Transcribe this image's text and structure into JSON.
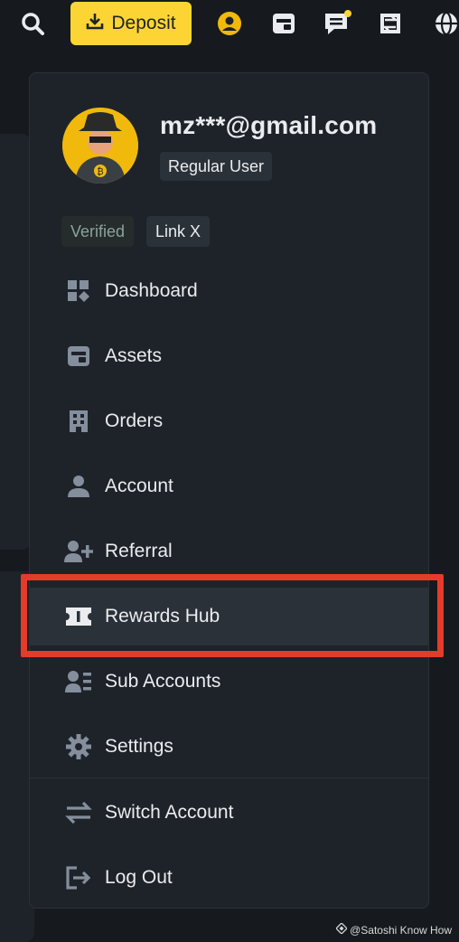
{
  "topbar": {
    "deposit_label": "Deposit",
    "icons": [
      "search-icon",
      "download-icon",
      "user-avatar-icon",
      "wallet-icon",
      "messages-icon",
      "transfer-icon",
      "globe-icon"
    ],
    "accent": "#fcd535"
  },
  "user": {
    "email": "mz***@gmail.com",
    "role": "Regular User",
    "verified_label": "Verified",
    "link_label": "Link X"
  },
  "menu": {
    "items": [
      {
        "label": "Dashboard",
        "icon": "dashboard-icon"
      },
      {
        "label": "Assets",
        "icon": "wallet-icon"
      },
      {
        "label": "Orders",
        "icon": "orders-icon"
      },
      {
        "label": "Account",
        "icon": "account-icon"
      },
      {
        "label": "Referral",
        "icon": "referral-icon"
      },
      {
        "label": "Rewards Hub",
        "icon": "ticket-icon"
      },
      {
        "label": "Sub Accounts",
        "icon": "sub-accounts-icon"
      },
      {
        "label": "Settings",
        "icon": "gear-icon"
      },
      {
        "label": "Switch Account",
        "icon": "switch-icon"
      },
      {
        "label": "Log Out",
        "icon": "logout-icon"
      }
    ],
    "active_index": 5
  },
  "highlight_color": "#e53b2a",
  "watermark": "@Satoshi Know How"
}
